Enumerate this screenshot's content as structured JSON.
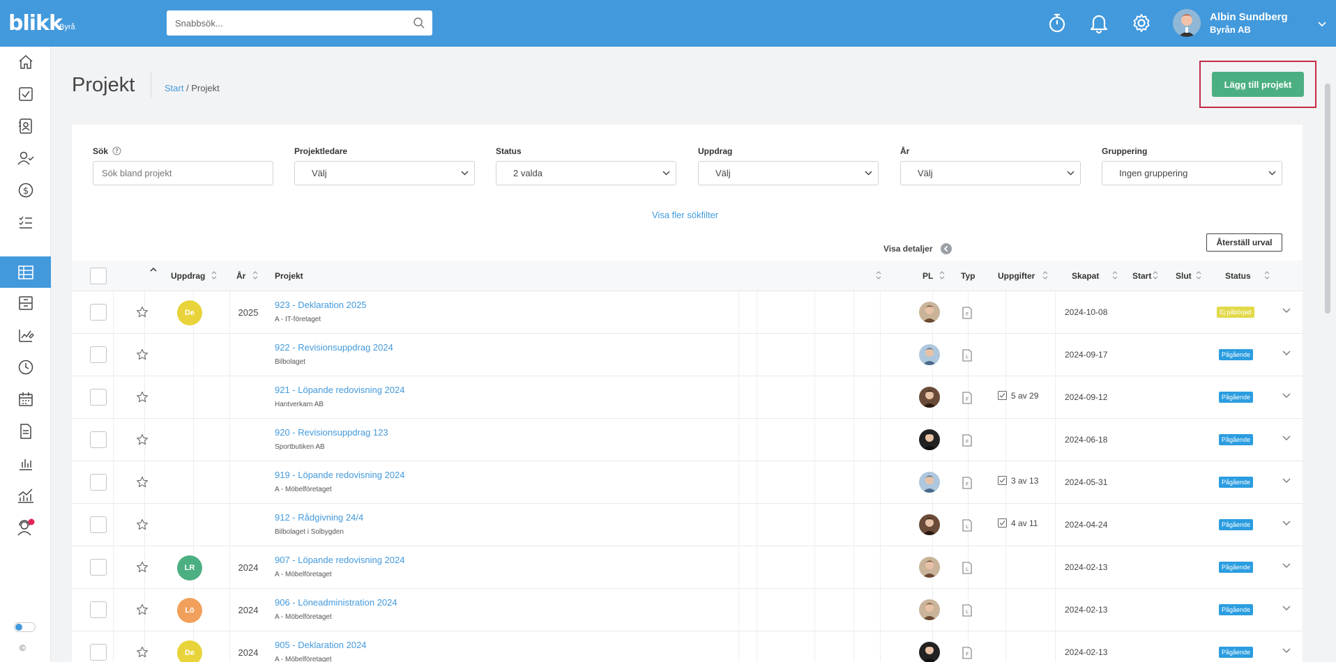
{
  "header": {
    "logo": "blikk",
    "logo_sub": "Byrå",
    "search_placeholder": "Snabbsök...",
    "user_name": "Albin Sundberg",
    "user_org": "Byrån AB"
  },
  "page": {
    "title": "Projekt",
    "breadcrumb_link": "Start",
    "breadcrumb_sep": " / ",
    "breadcrumb_current": "Projekt",
    "add_button": "Lägg till projekt"
  },
  "filters": {
    "search_label": "Sök",
    "search_placeholder": "Sök bland projekt",
    "items": [
      {
        "label": "Projektledare",
        "value": "Välj"
      },
      {
        "label": "Status",
        "value": "2 valda"
      },
      {
        "label": "Uppdrag",
        "value": "Välj"
      },
      {
        "label": "År",
        "value": "Välj"
      },
      {
        "label": "Gruppering",
        "value": "Ingen gruppering"
      }
    ],
    "more_filters": "Visa fler sökfilter",
    "show_details": "Visa detaljer",
    "reset": "Återställ urval"
  },
  "table": {
    "columns": {
      "uppdrag": "Uppdrag",
      "year": "År",
      "project": "Projekt",
      "pl": "PL",
      "typ": "Typ",
      "tasks": "Uppgifter",
      "created": "Skapat",
      "start": "Start",
      "end": "Slut",
      "status": "Status"
    },
    "rows": [
      {
        "badge": "De",
        "year": "2025",
        "title": "923 - Deklaration 2025",
        "client": "A - IT-företaget",
        "tasks": "",
        "created": "2024-10-08",
        "status": "Ej påbörjad"
      },
      {
        "badge": "",
        "year": "",
        "title": "922 - Revisionsuppdrag 2024",
        "client": "Bilbolaget",
        "tasks": "",
        "created": "2024-09-17",
        "status": "Pågående"
      },
      {
        "badge": "",
        "year": "",
        "title": "921 - Löpande redovisning 2024",
        "client": "Hantverkarn AB",
        "tasks": "5 av 29",
        "created": "2024-09-12",
        "status": "Pågående"
      },
      {
        "badge": "",
        "year": "",
        "title": "920 - Revisionsuppdrag 123",
        "client": "Sportbutiken AB",
        "tasks": "",
        "created": "2024-06-18",
        "status": "Pågående"
      },
      {
        "badge": "",
        "year": "",
        "title": "919 - Löpande redovisning 2024",
        "client": "A - Möbelföretaget",
        "tasks": "3 av 13",
        "created": "2024-05-31",
        "status": "Pågående"
      },
      {
        "badge": "",
        "year": "",
        "title": "912 - Rådgivning 24/4",
        "client": "Bilbolaget i Solbygden",
        "tasks": "4 av 11",
        "created": "2024-04-24",
        "status": "Pågående"
      },
      {
        "badge": "LR",
        "year": "2024",
        "title": "907 - Löpande redovisning 2024",
        "client": "A - Möbelföretaget",
        "tasks": "",
        "created": "2024-02-13",
        "status": "Pågående"
      },
      {
        "badge": "Lö",
        "year": "2024",
        "title": "906 - Löneadministration 2024",
        "client": "A - Möbelföretaget",
        "tasks": "",
        "created": "2024-02-13",
        "status": "Pågående"
      },
      {
        "badge": "De",
        "year": "2024",
        "title": "905 - Deklaration 2024",
        "client": "A - Möbelföretaget",
        "tasks": "",
        "created": "2024-02-13",
        "status": "Pågående"
      }
    ]
  },
  "footer": {
    "copyright": "©"
  },
  "colors": {
    "brand": "#4299dc",
    "add_button": "#4caf82",
    "highlight": "#c62a44",
    "status_active": "#2b9de0",
    "status_not_started": "#e2d94a"
  }
}
